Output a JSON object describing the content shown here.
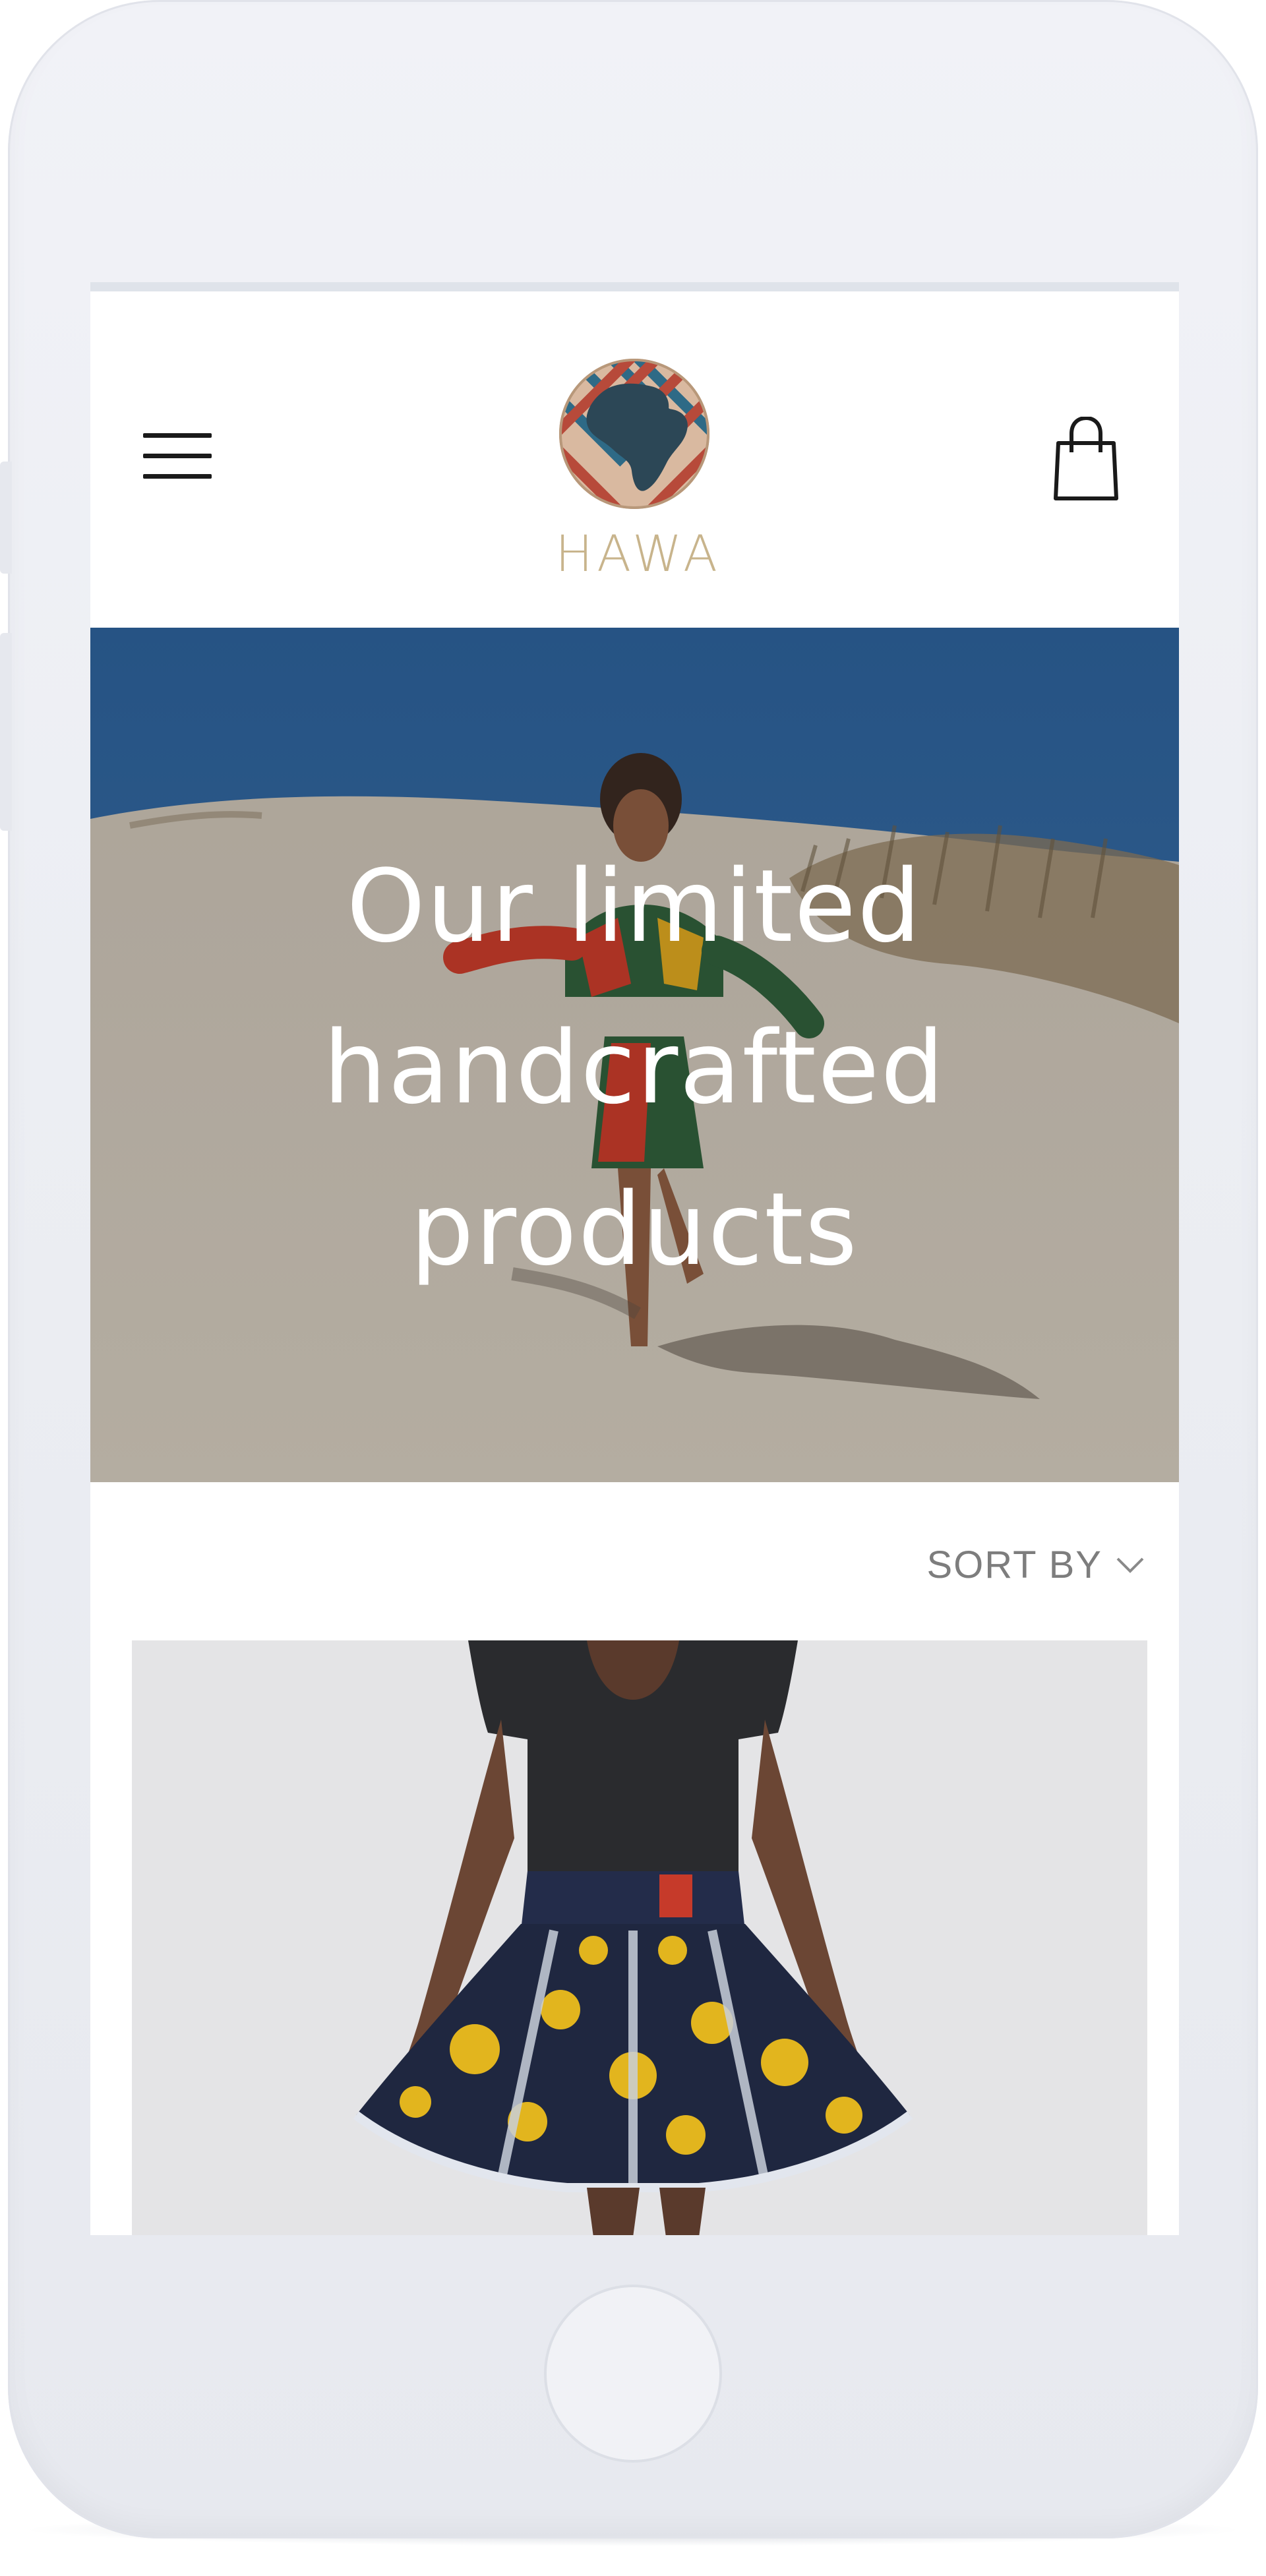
{
  "header": {
    "logo_text": "HAWA",
    "menu_icon": "hamburger-menu-icon",
    "cart_icon": "shopping-bag-icon"
  },
  "hero": {
    "title": "Our limited handcrafted products"
  },
  "sort": {
    "label": "SORT BY",
    "icon": "chevron-down-icon"
  },
  "products": [
    {
      "image": "product-photo-skirt"
    }
  ],
  "colors": {
    "logo_gold": "#c8b48c",
    "sky": "#2f64a0",
    "sand": "#cbc3b6",
    "sort_text": "#7d7d7d"
  }
}
